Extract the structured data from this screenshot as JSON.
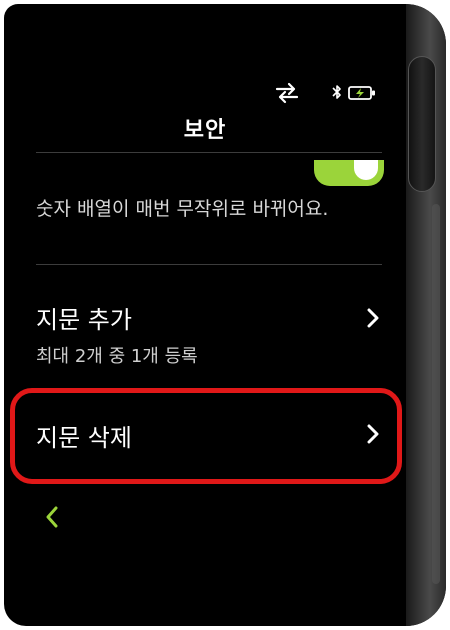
{
  "header": {
    "title": "보안",
    "icons": [
      "sync-icon",
      "bluetooth-icon",
      "battery-charging-icon"
    ]
  },
  "setting_partial": {
    "cut_label": "' ' ' ' ' '' ' ''",
    "description": "숫자 배열이 매번 무작위로 바뀌어요.",
    "toggle_on": true
  },
  "rows": [
    {
      "title": "지문 추가",
      "subtitle": "최대 2개 중 1개 등록"
    },
    {
      "title": "지문 삭제"
    }
  ],
  "colors": {
    "accent": "#9bd43a",
    "highlight": "#e01818",
    "background": "#000000"
  },
  "nav": {
    "back": "back-icon"
  }
}
